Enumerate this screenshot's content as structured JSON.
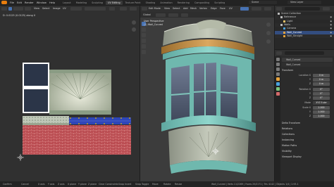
{
  "app": {
    "menu": [
      "File",
      "Edit",
      "Render",
      "Window",
      "Help"
    ],
    "workspaces": [
      "Layout",
      "Modeling",
      "Sculpting",
      "UV Editing",
      "Texture Paint",
      "Shading",
      "Animation",
      "Rendering",
      "Compositing",
      "Scripting"
    ],
    "active_workspace": "UV Editing",
    "scene": "Scene",
    "view_layer": "View Layer"
  },
  "uv_editor": {
    "view_label": "View",
    "select_label": "Select",
    "image_label": "Image",
    "uv_label": "UV",
    "readout": "D: 0.0125 (0.0125) along X"
  },
  "viewport": {
    "header": {
      "mode": "Edit Mode",
      "view": "View",
      "select": "Select",
      "add": "Add",
      "mesh": "Mesh",
      "vertex": "Vertex",
      "edge": "Edge",
      "face": "Face",
      "uv": "UV",
      "orientation": "Global"
    },
    "overlay_line1": "User Perspective",
    "overlay_line2": "(1) Wall_Curved"
  },
  "outliner": {
    "title": "Scene Collection",
    "items": [
      {
        "label": "Scene Collection",
        "indent": 0,
        "icon_color": "#bdbdbd"
      },
      {
        "label": "Reference",
        "indent": 1,
        "icon_color": "#bdbdbd"
      },
      {
        "label": "Light",
        "indent": 2,
        "icon_color": "#e9c46a"
      },
      {
        "label": "Walls",
        "indent": 1,
        "icon_color": "#bdbdbd"
      },
      {
        "label": "Camera",
        "indent": 2,
        "icon_color": "#4aa3df"
      },
      {
        "label": "Wall_Curved",
        "indent": 2,
        "icon_color": "#e8a33a",
        "selected": true
      },
      {
        "label": "Wall_Straight",
        "indent": 2,
        "icon_color": "#e8a33a"
      }
    ]
  },
  "properties": {
    "object_name": "Wall_Curved",
    "data_name": "Wall_Curved",
    "transform_title": "Transform",
    "location_label": "Location X",
    "location": [
      "0 m",
      "0 m",
      "0 m"
    ],
    "rotation_label": "Rotation X",
    "rotation": [
      "0°",
      "0°",
      "0°"
    ],
    "mode_label": "Mode",
    "mode_value": "XYZ Euler",
    "scale_label": "Scale X",
    "scale": [
      "1.000",
      "1.000",
      "1.000"
    ],
    "axis_y": "Y",
    "axis_z": "Z",
    "sections": [
      "Delta Transform",
      "Relations",
      "Collections",
      "Instancing",
      "Motion Paths",
      "Visibility",
      "Viewport Display"
    ]
  },
  "status": {
    "confirm": "Confirm",
    "cancel": "Cancel",
    "x_axis": "X axis",
    "y_axis": "Y axis",
    "z_axis": "Z axis",
    "x_plane": "X plane",
    "y_plane": "Y plane",
    "z_plane": "Z plane",
    "clear": "Clear Constraints",
    "snap_invert": "Snap Invert",
    "snap_toggle": "Snap Toggle",
    "move": "Move",
    "rotate": "Rotate",
    "resize": "Resize",
    "stats": "Wall_Curved | Verts 11/2269 | Faces 25/2171 | Tris 4142 | Objects 1/4 | 2.93.1"
  },
  "colors": {
    "accent_blue": "#4772b3",
    "selected_row": "#334d80",
    "brand_orange": "#e87d0d"
  }
}
